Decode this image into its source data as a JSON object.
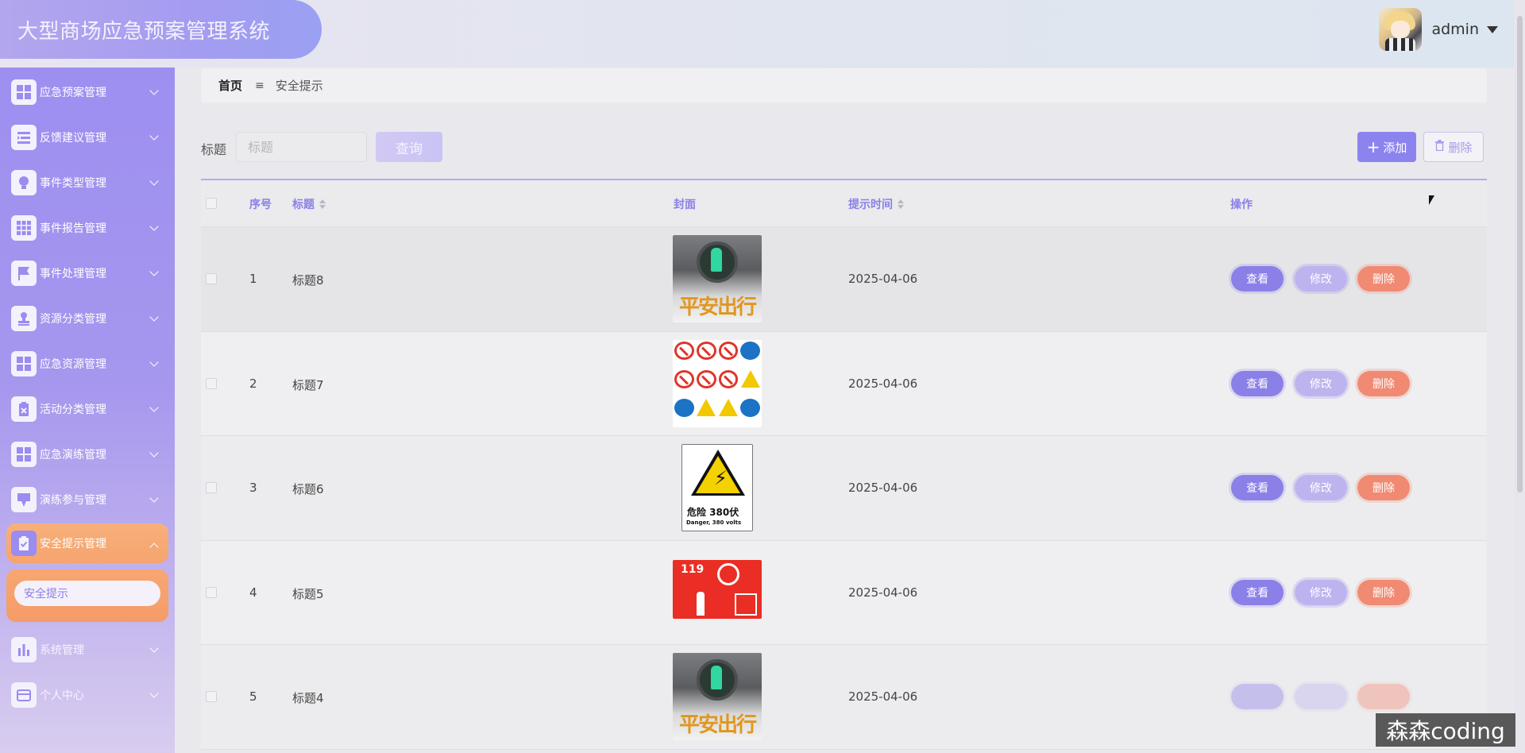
{
  "app": {
    "title": "大型商场应急预案管理系统"
  },
  "user": {
    "name": "admin"
  },
  "sidebar": {
    "items": [
      {
        "label": "应急预案管理",
        "icon": "grid-icon"
      },
      {
        "label": "反馈建议管理",
        "icon": "list-icon"
      },
      {
        "label": "事件类型管理",
        "icon": "bulb-icon"
      },
      {
        "label": "事件报告管理",
        "icon": "apps-icon"
      },
      {
        "label": "事件处理管理",
        "icon": "flag-icon"
      },
      {
        "label": "资源分类管理",
        "icon": "stamp-icon"
      },
      {
        "label": "应急资源管理",
        "icon": "grid-icon"
      },
      {
        "label": "活动分类管理",
        "icon": "clipboard-x-icon"
      },
      {
        "label": "应急演练管理",
        "icon": "grid-icon"
      },
      {
        "label": "演练参与管理",
        "icon": "pen-icon"
      },
      {
        "label": "安全提示管理",
        "icon": "clipboard-check-icon"
      },
      {
        "label": "系统管理",
        "icon": "bar-chart-icon"
      },
      {
        "label": "个人中心",
        "icon": "wallet-icon"
      }
    ],
    "active_submenu": "安全提示"
  },
  "breadcrumb": {
    "home": "首页",
    "separator": "≡",
    "current": "安全提示"
  },
  "search": {
    "label": "标题",
    "placeholder": "标题",
    "button": "查询"
  },
  "toolbar": {
    "add": "添加",
    "delete": "删除"
  },
  "table": {
    "headers": {
      "index": "序号",
      "title": "标题",
      "cover": "封面",
      "time": "提示时间",
      "ops": "操作"
    },
    "rows": [
      {
        "index": "1",
        "title": "标题8",
        "time": "2025-04-06",
        "cover": "traffic"
      },
      {
        "index": "2",
        "title": "标题7",
        "time": "2025-04-06",
        "cover": "signs"
      },
      {
        "index": "3",
        "title": "标题6",
        "time": "2025-04-06",
        "cover": "danger"
      },
      {
        "index": "4",
        "title": "标题5",
        "time": "2025-04-06",
        "cover": "fire"
      },
      {
        "index": "5",
        "title": "标题4",
        "time": "2025-04-06",
        "cover": "traffic"
      }
    ],
    "ops": {
      "view": "查看",
      "edit": "修改",
      "delete": "删除"
    }
  },
  "cover_text": {
    "traffic": "平安出行",
    "danger_cn": "危险  380伏",
    "danger_en": "Danger, 380 volts",
    "fire_number": "119"
  },
  "watermark": "森森coding"
}
